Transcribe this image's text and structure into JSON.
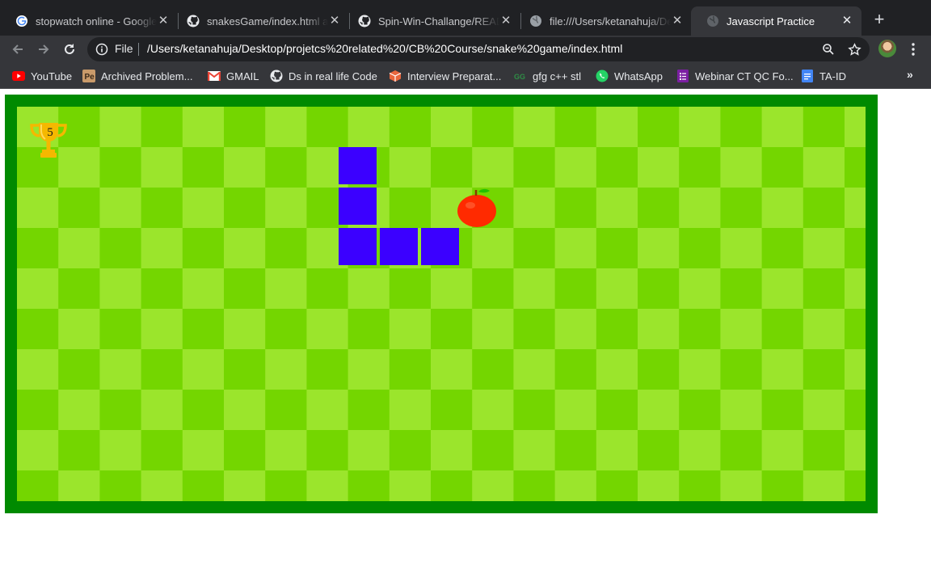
{
  "tabs": [
    {
      "title": "stopwatch online - Google Search",
      "favicon": "google-icon",
      "active": false
    },
    {
      "title": "snakesGame/index.html at master",
      "favicon": "github-icon",
      "active": false
    },
    {
      "title": "Spin-Win-Challange/README.md",
      "favicon": "github-icon",
      "active": false
    },
    {
      "title": "file:///Users/ketanahuja/Desktop",
      "favicon": "globe-icon",
      "active": false
    },
    {
      "title": "Javascript Practice",
      "favicon": "globe-icon",
      "active": true
    }
  ],
  "omnibox": {
    "scheme": "File",
    "url": "/Users/ketanahuja/Desktop/projetcs%20related%20/CB%20Course/snake%20game/index.html"
  },
  "bookmarks": [
    {
      "label": "YouTube",
      "icon": "youtube-icon"
    },
    {
      "label": "Archived Problem...",
      "icon": "archived-problems-icon"
    },
    {
      "label": "GMAIL",
      "icon": "gmail-icon"
    },
    {
      "label": "Ds in real life Code",
      "icon": "github-icon"
    },
    {
      "label": "Interview Preparat...",
      "icon": "interview-prep-icon"
    },
    {
      "label": "gfg c++ stl",
      "icon": "gfg-icon"
    },
    {
      "label": "WhatsApp",
      "icon": "whatsapp-icon"
    },
    {
      "label": "Webinar CT QC Fo...",
      "icon": "forms-icon"
    },
    {
      "label": "TA-ID",
      "icon": "docs-icon"
    }
  ],
  "game": {
    "score": "5",
    "board_cols": 21,
    "board_rows": 10,
    "snake_cells": [
      [
        8,
        1
      ],
      [
        8,
        2
      ],
      [
        8,
        3
      ],
      [
        9,
        3
      ],
      [
        10,
        3
      ]
    ],
    "food_cell": [
      11,
      2
    ],
    "colors": {
      "border": "#008a00",
      "light_tile": "#9be52c",
      "dark_tile": "#74d600",
      "snake": "#3b00ff",
      "food": "#ff2a00",
      "trophy": "#f5b800"
    }
  }
}
